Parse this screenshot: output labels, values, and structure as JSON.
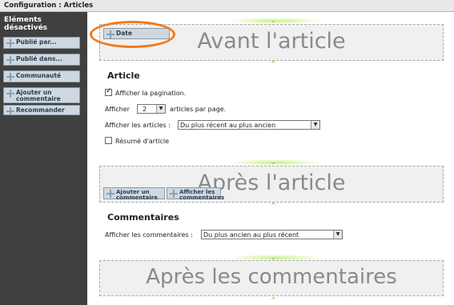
{
  "window": {
    "title": "Configuration : Articles"
  },
  "sidebar": {
    "title": "Eléments désactivés",
    "items": [
      {
        "label": "Publié par..."
      },
      {
        "label": "Publié dans..."
      },
      {
        "label": "Communauté"
      },
      {
        "label": "Ajouter un commentaire"
      },
      {
        "label": "Recommander"
      }
    ]
  },
  "zones": {
    "before": {
      "label": "Avant l'article",
      "items": [
        {
          "label": "Date"
        }
      ]
    },
    "after": {
      "label": "Après l'article",
      "items": [
        {
          "label": "Ajouter un commentaire"
        },
        {
          "label": "Afficher les commentaires"
        }
      ]
    },
    "after_comments": {
      "label": "Après les commentaires"
    }
  },
  "article": {
    "title": "Article",
    "pagination_label": "Afficher la pagination.",
    "pagination_checked": true,
    "show_prefix": "Afficher",
    "per_page_value": "2",
    "per_page_suffix": "articles par page.",
    "order_label": "Afficher les articles :",
    "order_value": "Du plus récent au plus ancien",
    "summary_label": "Résumé d'article",
    "summary_checked": false
  },
  "comments": {
    "title": "Commentaires",
    "order_label": "Afficher les commentaires :",
    "order_value": "Du plus ancien au plus récent"
  },
  "colors": {
    "sidebar_bg": "#404040",
    "tile_bg": "#cfd8e0",
    "zone_bg": "#f0f0f0",
    "highlight": "#f07a1e",
    "drop_indicator": "#8cc838"
  }
}
